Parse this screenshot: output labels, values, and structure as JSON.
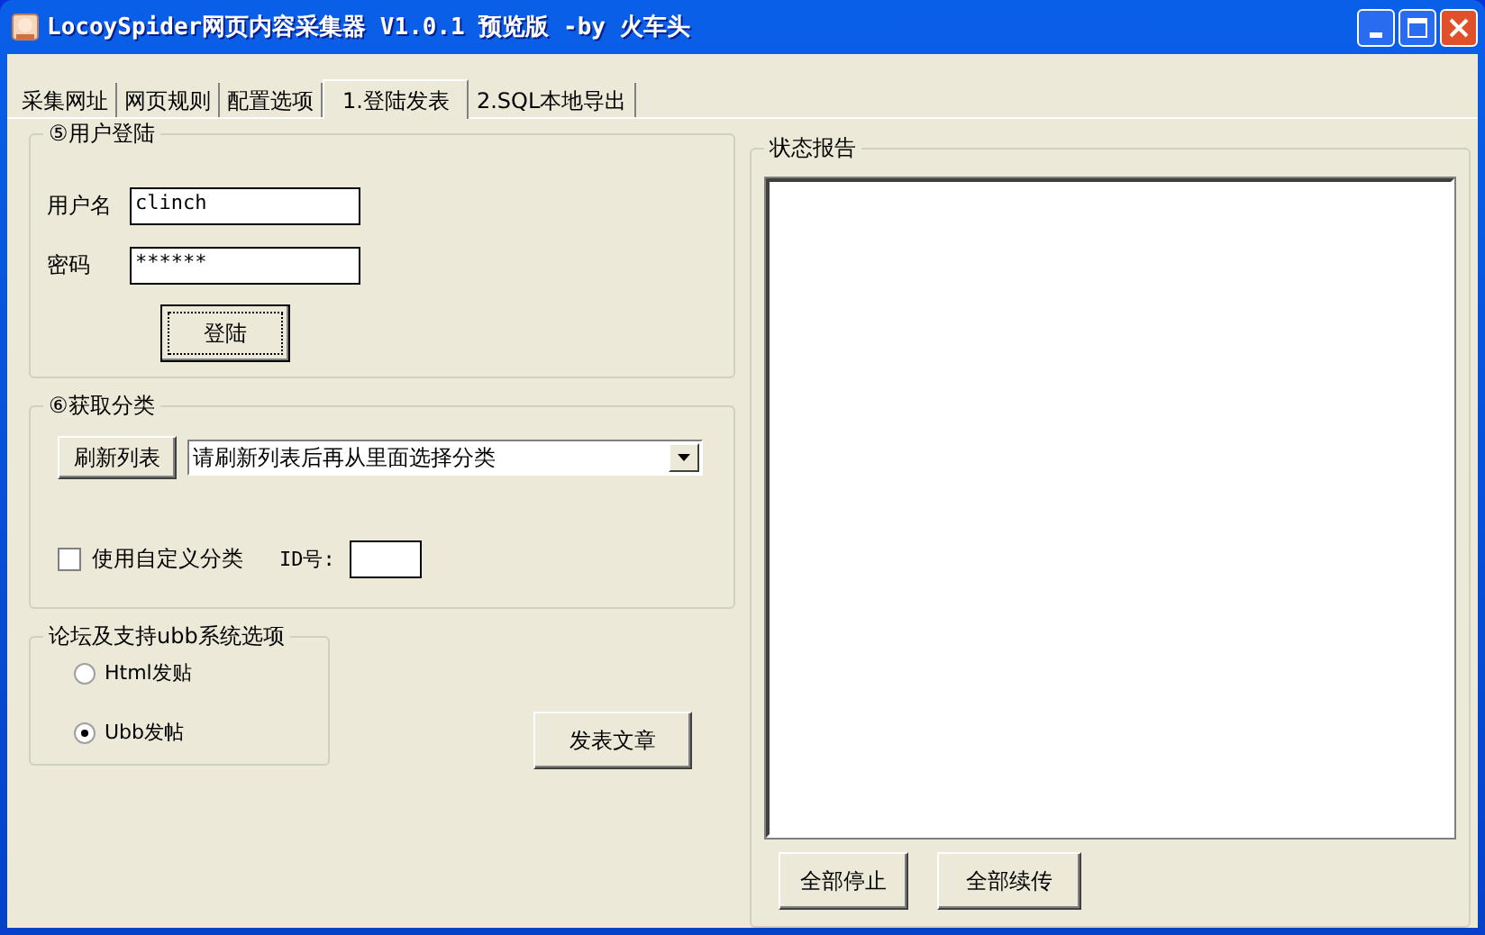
{
  "window": {
    "title": "LocoySpider网页内容采集器 V1.0.1 预览版 -by 火车头"
  },
  "tabs": [
    {
      "label": "采集网址",
      "selected": false
    },
    {
      "label": "网页规则",
      "selected": false
    },
    {
      "label": "配置选项",
      "selected": false
    },
    {
      "label": "1.登陆发表",
      "selected": true
    },
    {
      "label": "2.SQL本地导出",
      "selected": false
    }
  ],
  "login": {
    "title": "⑤用户登陆",
    "username_label": "用户名",
    "username": "clinch",
    "password_label": "密码",
    "password": "******",
    "login_button": "登陆"
  },
  "category": {
    "title": "⑥获取分类",
    "refresh_button": "刷新列表",
    "dropdown": "请刷新列表后再从里面选择分类",
    "custom_label": "使用自定义分类",
    "custom_checked": false,
    "id_label": "ID号:"
  },
  "post_mode": {
    "title": "论坛及支持ubb系统选项",
    "options": [
      {
        "label": "Html发贴",
        "selected": false
      },
      {
        "label": "Ubb发帖",
        "selected": true
      }
    ]
  },
  "publish_button": "发表文章",
  "status": {
    "title": "状态报告"
  },
  "buttons": [
    "全部停止",
    "全部续传"
  ]
}
